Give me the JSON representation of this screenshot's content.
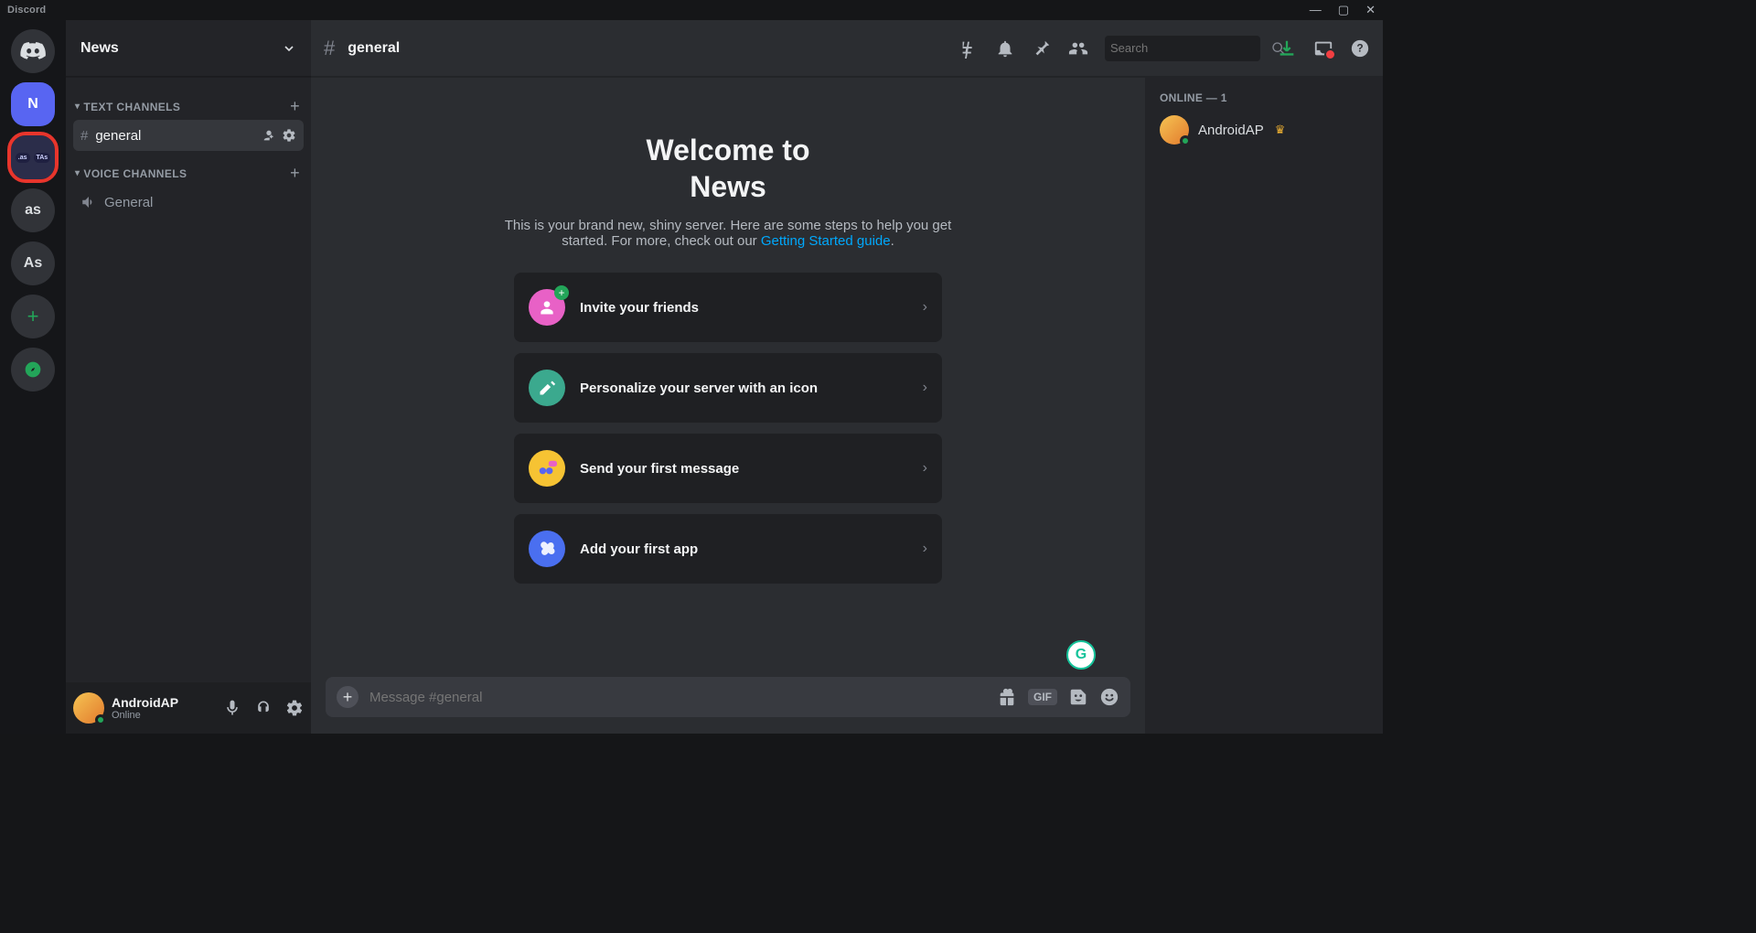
{
  "app": {
    "brand": "Discord"
  },
  "server_rail": {
    "selected_server_initial": "N",
    "folder_items": [
      ".as",
      "TAs"
    ],
    "servers": [
      {
        "initial": "as"
      },
      {
        "initial": "As"
      }
    ]
  },
  "server_header": {
    "name": "News"
  },
  "channel_categories": {
    "text_label": "TEXT CHANNELS",
    "voice_label": "VOICE CHANNELS"
  },
  "channels": {
    "text": [
      {
        "name": "general",
        "active": true
      }
    ],
    "voice": [
      {
        "name": "General"
      }
    ]
  },
  "user": {
    "name": "AndroidAP",
    "status": "Online"
  },
  "toolbar": {
    "channel_name": "general",
    "search_placeholder": "Search"
  },
  "welcome": {
    "title_line1": "Welcome to",
    "title_line2": "News",
    "subtitle_prefix": "This is your brand new, shiny server. Here are some steps to help you get started. For more, check out our ",
    "guide_link_text": "Getting Started guide",
    "subtitle_suffix": ".",
    "cards": {
      "invite": "Invite your friends",
      "personalize": "Personalize your server with an icon",
      "first_message": "Send your first message",
      "add_app": "Add your first app"
    }
  },
  "composer": {
    "placeholder": "Message #general",
    "gif_label": "GIF"
  },
  "members": {
    "header": "ONLINE — 1",
    "list": [
      {
        "name": "AndroidAP",
        "owner": true
      }
    ]
  }
}
